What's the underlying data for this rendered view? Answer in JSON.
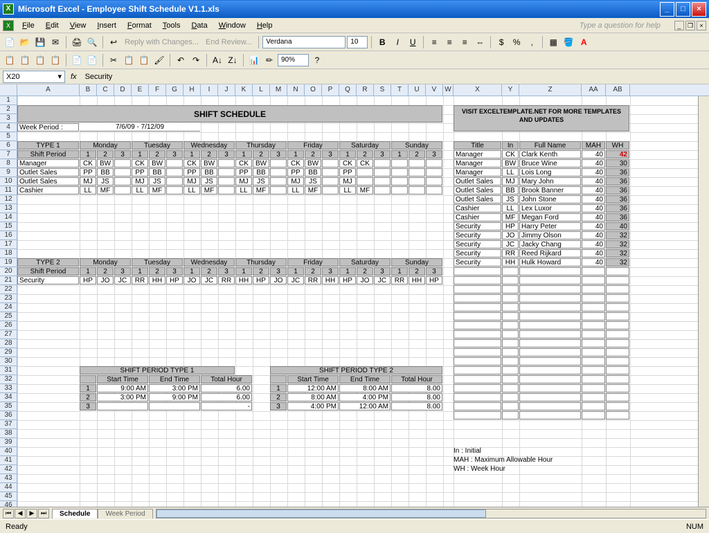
{
  "window": {
    "title": "Microsoft Excel - Employee Shift Schedule V1.1.xls"
  },
  "menu": {
    "items": [
      "File",
      "Edit",
      "View",
      "Insert",
      "Format",
      "Tools",
      "Data",
      "Window",
      "Help"
    ],
    "help_placeholder": "Type a question for help"
  },
  "toolbar2": {
    "reply": "Reply with Changes...",
    "end": "End Review...",
    "font": "Verdana",
    "size": "10",
    "zoom": "90%"
  },
  "namebox": {
    "ref": "X20",
    "fx": "fx",
    "formula": "Security"
  },
  "cols": [
    "A",
    "B",
    "C",
    "D",
    "E",
    "F",
    "G",
    "H",
    "I",
    "J",
    "K",
    "L",
    "M",
    "N",
    "O",
    "P",
    "Q",
    "R",
    "S",
    "T",
    "U",
    "V",
    "W",
    "X",
    "Y",
    "Z",
    "AA",
    "AB"
  ],
  "sheet": {
    "title": "SHIFT SCHEDULE",
    "banner": "VISIT EXCELTEMPLATE.NET FOR MORE TEMPLATES AND UPDATES",
    "week_label": "Week Period :",
    "week_value": "7/6/09 - 7/12/09",
    "days": [
      "Monday",
      "Tuesday",
      "Wednesday",
      "Thursday",
      "Friday",
      "Saturday",
      "Sunday"
    ],
    "type1": "TYPE 1",
    "type2": "TYPE 2",
    "shift_period": "Shift Period",
    "nums": [
      "1",
      "2",
      "3"
    ],
    "t1rows": [
      {
        "label": "Manager",
        "cells": [
          "CK",
          "BW",
          "",
          "CK",
          "BW",
          "",
          "CK",
          "BW",
          "",
          "CK",
          "BW",
          "",
          "CK",
          "BW",
          "",
          "CK",
          "CK",
          "",
          "",
          "",
          ""
        ]
      },
      {
        "label": "Outlet Sales",
        "cells": [
          "PP",
          "BB",
          "",
          "PP",
          "BB",
          "",
          "PP",
          "BB",
          "",
          "PP",
          "BB",
          "",
          "PP",
          "BB",
          "",
          "PP",
          "",
          "",
          "",
          "",
          ""
        ]
      },
      {
        "label": "Outlet Sales",
        "cells": [
          "MJ",
          "JS",
          "",
          "MJ",
          "JS",
          "",
          "MJ",
          "JS",
          "",
          "MJ",
          "JS",
          "",
          "MJ",
          "JS",
          "",
          "MJ",
          "",
          "",
          "",
          "",
          ""
        ]
      },
      {
        "label": "Cashier",
        "cells": [
          "LL",
          "MF",
          "",
          "LL",
          "MF",
          "",
          "LL",
          "MF",
          "",
          "LL",
          "MF",
          "",
          "LL",
          "MF",
          "",
          "LL",
          "MF",
          "",
          "",
          "",
          ""
        ]
      }
    ],
    "t2rows": [
      {
        "label": "Security",
        "cells": [
          "HP",
          "JO",
          "JC",
          "RR",
          "HH",
          "HP",
          "JO",
          "JC",
          "RR",
          "HH",
          "HP",
          "JO",
          "JC",
          "RR",
          "HH",
          "HP",
          "JO",
          "JC",
          "RR",
          "HH",
          "HP"
        ]
      }
    ],
    "sp1_title": "SHIFT PERIOD TYPE 1",
    "sp2_title": "SHIFT PERIOD TYPE 2",
    "sp_headers": [
      "Start Time",
      "End Time",
      "Total Hour"
    ],
    "sp1": [
      {
        "n": "1",
        "s": "9:00 AM",
        "e": "3:00 PM",
        "t": "6.00"
      },
      {
        "n": "2",
        "s": "3:00 PM",
        "e": "9:00 PM",
        "t": "6.00"
      },
      {
        "n": "3",
        "s": "",
        "e": "",
        "t": "-"
      }
    ],
    "sp2": [
      {
        "n": "1",
        "s": "12:00 AM",
        "e": "8:00 AM",
        "t": "8.00"
      },
      {
        "n": "2",
        "s": "8:00 AM",
        "e": "4:00 PM",
        "t": "8.00"
      },
      {
        "n": "3",
        "s": "4:00 PM",
        "e": "12:00 AM",
        "t": "8.00"
      }
    ],
    "emp_headers": [
      "Title",
      "In",
      "Full Name",
      "MAH",
      "WH"
    ],
    "employees": [
      {
        "title": "Manager",
        "in": "CK",
        "name": "Clark Kenth",
        "mah": "40",
        "wh": "42",
        "red": true
      },
      {
        "title": "Manager",
        "in": "BW",
        "name": "Bruce Wine",
        "mah": "40",
        "wh": "30"
      },
      {
        "title": "Manager",
        "in": "LL",
        "name": "Lois Long",
        "mah": "40",
        "wh": "36"
      },
      {
        "title": "Outlet Sales",
        "in": "MJ",
        "name": "Mary John",
        "mah": "40",
        "wh": "36"
      },
      {
        "title": "Outlet Sales",
        "in": "BB",
        "name": "Brook Banner",
        "mah": "40",
        "wh": "36"
      },
      {
        "title": "Outlet Sales",
        "in": "JS",
        "name": "John Stone",
        "mah": "40",
        "wh": "36"
      },
      {
        "title": "Cashier",
        "in": "LL",
        "name": "Lex Luxor",
        "mah": "40",
        "wh": "36"
      },
      {
        "title": "Cashier",
        "in": "MF",
        "name": "Megan Ford",
        "mah": "40",
        "wh": "36"
      },
      {
        "title": "Security",
        "in": "HP",
        "name": "Harry Peter",
        "mah": "40",
        "wh": "40"
      },
      {
        "title": "Security",
        "in": "JO",
        "name": "Jimmy Olson",
        "mah": "40",
        "wh": "32"
      },
      {
        "title": "Security",
        "in": "JC",
        "name": "Jacky Chang",
        "mah": "40",
        "wh": "32"
      },
      {
        "title": "Security",
        "in": "RR",
        "name": "Reed Rijkard",
        "mah": "40",
        "wh": "32"
      },
      {
        "title": "Security",
        "in": "HH",
        "name": "Hulk Howard",
        "mah": "40",
        "wh": "32"
      }
    ],
    "legend": [
      "In : Initial",
      "MAH : Maximum Allowable Hour",
      "WH : Week Hour"
    ]
  },
  "tabs": {
    "active": "Schedule",
    "other": "Week Period"
  },
  "status": {
    "ready": "Ready",
    "num": "NUM"
  }
}
